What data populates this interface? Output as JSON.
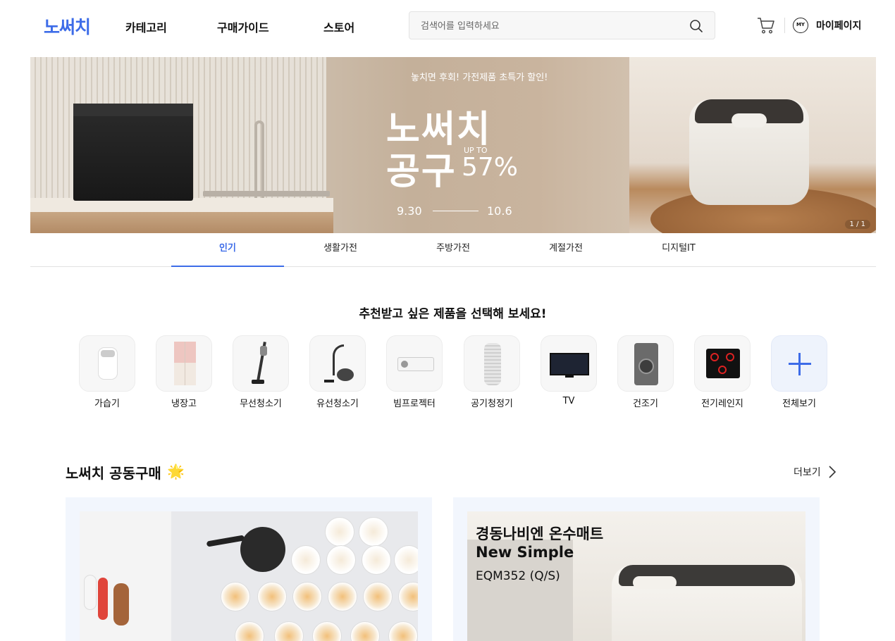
{
  "header": {
    "logo": "노써치",
    "nav": [
      "카테고리",
      "구매가이드",
      "스토어"
    ],
    "search_placeholder": "검색어를 입력하세요",
    "my_badge": "MY",
    "mypage_label": "마이페이지"
  },
  "banner": {
    "subtitle": "놓치면 후회! 가전제품 초특가 할인!",
    "title_line1": "노써치",
    "title_line2": "공구",
    "upto": "UP TO",
    "discount": "57%",
    "date_start": "9.30",
    "date_end": "10.6",
    "page_indicator": "1 / 1"
  },
  "tabs": [
    {
      "label": "인기",
      "active": true
    },
    {
      "label": "생활가전",
      "active": false
    },
    {
      "label": "주방가전",
      "active": false
    },
    {
      "label": "계절가전",
      "active": false
    },
    {
      "label": "디지털IT",
      "active": false
    }
  ],
  "recommend": {
    "title": "추천받고 싶은 제품을 선택해 보세요!",
    "items": [
      "가습기",
      "냉장고",
      "무선청소기",
      "유선청소기",
      "빔프로젝터",
      "공기청정기",
      "TV",
      "건조기",
      "전기레인지",
      "전체보기"
    ]
  },
  "group_buy": {
    "title": "노써치 공동구매",
    "sparkle": "🌟",
    "more_label": "더보기",
    "card2_headline": "경동나비엔 온수매트",
    "card2_subline": "New Simple",
    "card2_model": "EQM352 (Q/S)"
  },
  "colors": {
    "accent": "#3d6ce8",
    "card_bg": "#f2f6fd"
  }
}
